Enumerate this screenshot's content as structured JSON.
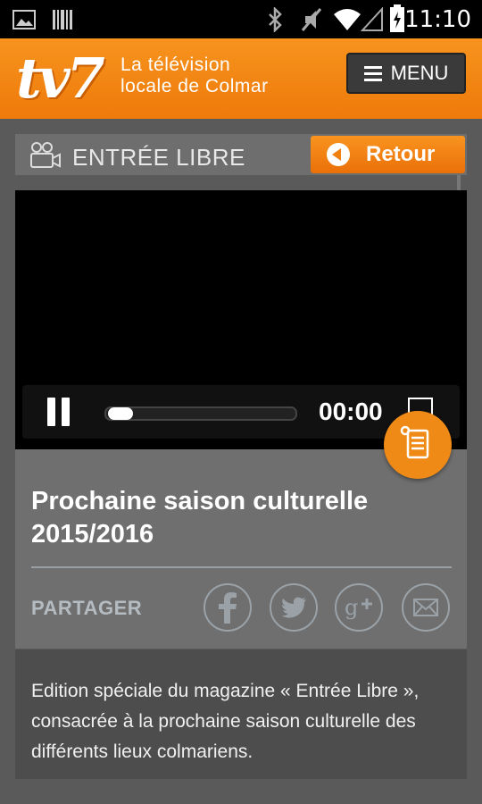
{
  "status_bar": {
    "time": "11:10"
  },
  "header": {
    "logo": "tv7",
    "tagline_line1": "La télévision",
    "tagline_line2": "locale de Colmar",
    "menu_label": "MENU"
  },
  "section": {
    "title": "ENTRÉE LIBRE",
    "back_label": "Retour"
  },
  "player": {
    "time": "00:00",
    "progress": 0
  },
  "article": {
    "title": "Prochaine saison culturelle 2015/2016",
    "share_label": "PARTAGER",
    "share_icons": [
      "facebook-icon",
      "twitter-icon",
      "google-plus-icon",
      "email-icon"
    ],
    "description": "Edition spéciale du magazine « Entrée Libre », consacrée à la prochaine saison culturelle des différents lieux colmariens."
  },
  "colors": {
    "accent": "#f08a16",
    "panel": "#6f6f6f",
    "background": "#5a5a5a"
  }
}
